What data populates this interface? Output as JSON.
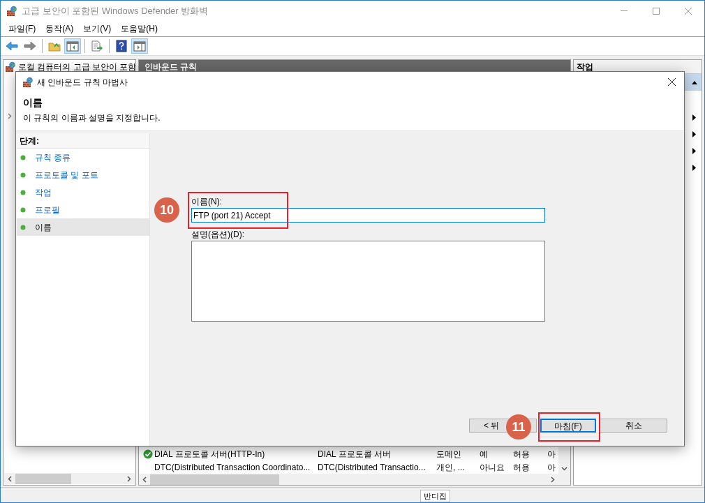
{
  "window": {
    "title": "고급 보안이 포함된 Windows Defender 방화벽"
  },
  "menu": [
    "파일(F)",
    "동작(A)",
    "보기(V)",
    "도움말(H)"
  ],
  "toolbar": [
    {
      "kind": "back",
      "pressed": false
    },
    {
      "kind": "forward",
      "pressed": false
    },
    {
      "kind": "folder",
      "pressed": false
    },
    {
      "kind": "tree",
      "pressed": true
    },
    {
      "kind": "export",
      "pressed": false
    },
    {
      "kind": "help",
      "pressed": false
    },
    {
      "kind": "pane",
      "pressed": true
    }
  ],
  "left_pane": {
    "header": "로컬 컴퓨터의 고급 보안이 포함"
  },
  "center_pane": {
    "header": "인바운드 규칙",
    "rows": [
      {
        "enabled": true,
        "cells": [
          "DIAL 프로토콜 서버(HTTP-In)",
          "DIAL 프로토콜 서버",
          "도메인",
          "예",
          "허용",
          "아"
        ]
      },
      {
        "enabled": false,
        "cells": [
          "DTC(Distributed Transaction Coordinato...",
          "DTC(Distributed Transactio...",
          "개인, ...",
          "아니요",
          "허용",
          "아"
        ]
      }
    ]
  },
  "right_pane": {
    "header": "작업"
  },
  "status_bar": {
    "tooltip": "반디집"
  },
  "dialog": {
    "title": "새 인바운드 규칙 마법사",
    "heading": "이름",
    "subtitle": "이 규칙의 이름과 설명을 지정합니다.",
    "steps_header": "단계:",
    "steps": [
      {
        "label": "규칙 종류",
        "selected": false
      },
      {
        "label": "프로토콜 및 포트",
        "selected": false
      },
      {
        "label": "작업",
        "selected": false
      },
      {
        "label": "프로필",
        "selected": false
      },
      {
        "label": "이름",
        "selected": true
      }
    ],
    "name_label": "이름(N):",
    "name_value": "FTP (port 21) Accept",
    "description_label": "설명(옵션)(D):",
    "buttons": [
      {
        "label": "< 뒤",
        "focused": false
      },
      {
        "label": "마침(F)",
        "focused": true
      },
      {
        "label": "취소",
        "focused": false
      }
    ]
  },
  "callouts": [
    {
      "number": "10"
    },
    {
      "number": "11"
    }
  ]
}
